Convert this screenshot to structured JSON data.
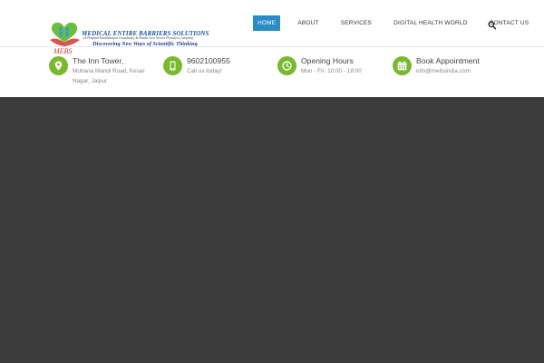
{
  "logo": {
    "title": "MEDICAL ENTIRE BARRIERS SOLUTIONS",
    "subtitle": "(A Hospital Establishment Consultancy & Health Care Service Providers Company)",
    "tagline": "Discovering New Ways of Scientific Thinking",
    "abbr": "MEBS"
  },
  "nav": {
    "items": [
      {
        "label": "HOME",
        "active": true
      },
      {
        "label": "ABOUT"
      },
      {
        "label": "SERVICES"
      },
      {
        "label": "DIGITAL HEALTH WORLD"
      },
      {
        "label": "CONTACT US"
      }
    ],
    "search_icon": "search-icon"
  },
  "info": {
    "address": {
      "title": "The Inn Tower,",
      "line1": "Muhana Mandi Road, Kesar",
      "line2": "Nagar, Jaipur",
      "icon": "map-marker-icon"
    },
    "phone": {
      "title": "9602100955",
      "line1": "Call us today!",
      "icon": "mobile-phone-icon"
    },
    "hours": {
      "title": "Opening Hours",
      "line1": "Mon - Fri: 10:00 - 18:00",
      "icon": "clock-icon"
    },
    "appointment": {
      "title": "Book Appointment",
      "line1": "info@mebsindia.com",
      "icon": "calendar-icon"
    }
  },
  "colors": {
    "accent_green": "#7ab82f",
    "nav_active": "#2b8bc6",
    "hero_bg": "#3c3c3c"
  }
}
